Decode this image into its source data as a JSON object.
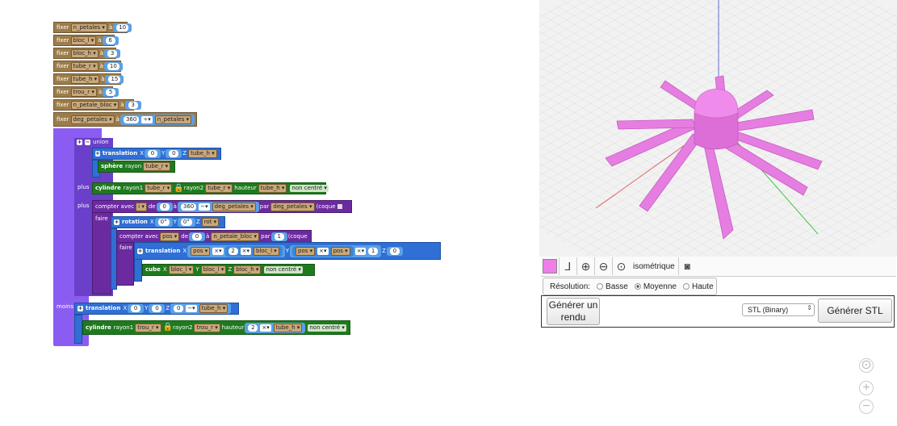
{
  "blocks": {
    "set_kw": "fixer",
    "to_kw": "à",
    "vars": [
      {
        "name": "n_petales",
        "value": "10"
      },
      {
        "name": "bloc_l",
        "value": "6"
      },
      {
        "name": "bloc_h",
        "value": "3"
      },
      {
        "name": "tube_r",
        "value": "10"
      },
      {
        "name": "tube_h",
        "value": "15"
      },
      {
        "name": "trou_r",
        "value": "5"
      },
      {
        "name": "n_petale_bloc",
        "value": "3"
      }
    ],
    "deg": {
      "name": "deg_petales",
      "num": "360",
      "op": "÷",
      "var": "n_petales"
    },
    "difference": "soustraction",
    "union": "union",
    "plus": "plus",
    "minus": "moins",
    "translation": "translation",
    "sphere": "sphère",
    "radius": "rayon",
    "cylinder": "cylindre",
    "radius1": "rayon1",
    "radius2": "rayon2",
    "height": "hauteur",
    "not_centered": "non centré",
    "count_with": "compter avec",
    "from": "de",
    "to": "à",
    "by": "par",
    "hull": "(coque",
    "do": "faire",
    "rotation": "rotation",
    "cube": "cube",
    "x": "X",
    "y": "Y",
    "z": "Z",
    "zero": "0",
    "zero_deg": "0°",
    "one": "1",
    "two": "2",
    "mul": "×",
    "minus_op": "−",
    "i": "i",
    "pos": "pos",
    "rot": "rot",
    "tube_h": "tube_h",
    "tube_r": "tube_r",
    "trou_r": "trou_r",
    "bloc_l": "bloc_l",
    "bloc_h": "bloc_h",
    "n_petale_bloc": "n_petale_bloc",
    "deg_petales": "deg_petales",
    "num360": "360"
  },
  "viewer": {
    "color_swatch": "#ee7ee8",
    "view_label": "isométrique",
    "resolution_label": "Résolution:",
    "res_options": [
      "Basse",
      "Moyenne",
      "Haute"
    ],
    "res_selected": "Moyenne",
    "render_button": "Générer un rendu",
    "format_select": "STL (Binary)",
    "stl_button": "Générer STL",
    "axis_icon": "axes-icon",
    "zoom_in_icon": "zoom-in-icon",
    "zoom_out_icon": "zoom-out-icon",
    "center_icon": "target-icon",
    "camera_icon": "camera-icon"
  },
  "workspace_controls": [
    "target-icon",
    "zoom-in-icon",
    "zoom-out-icon"
  ]
}
